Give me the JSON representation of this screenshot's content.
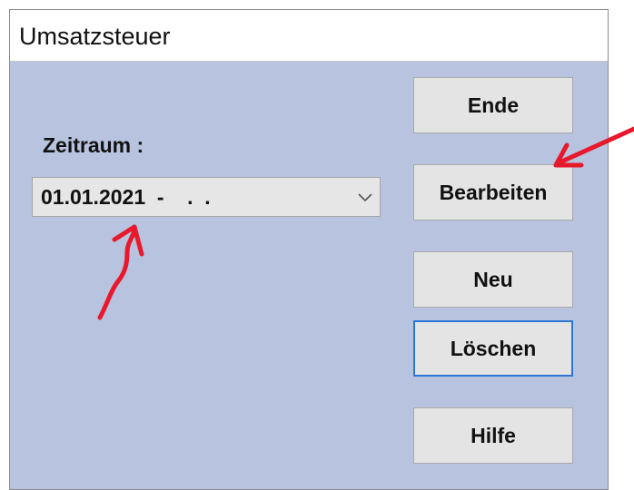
{
  "window": {
    "title": "Umsatzsteuer"
  },
  "period": {
    "label": "Zeitraum :",
    "value": "01.01.2021  -    .  .",
    "dropdown_icon": "chevron-down-icon"
  },
  "buttons": {
    "end": "Ende",
    "edit": "Bearbeiten",
    "new": "Neu",
    "delete": "Löschen",
    "help": "Hilfe"
  },
  "annotations": {
    "arrow_color": "#e8192c"
  },
  "colors": {
    "window_background": "#b8c4df",
    "focus_border": "#2a78d4"
  }
}
